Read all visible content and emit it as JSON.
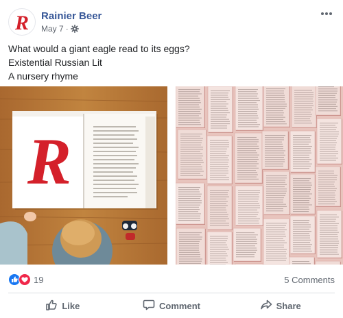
{
  "post": {
    "page_name": "Rainier Beer",
    "date": "May 7",
    "separator": "·",
    "audience_icon": "gear-icon",
    "more_icon": "more-options-icon",
    "text_lines": [
      "What would a giant eagle read to its eggs?",
      "Existential Russian Lit",
      "A nursery rhyme"
    ],
    "brand_color": "#d4202a"
  },
  "photos": [
    {
      "name": "photo-child-reading-book",
      "letter": "R"
    },
    {
      "name": "photo-book-pages-collage"
    }
  ],
  "reactions": {
    "icons": [
      "like-reaction-icon",
      "love-reaction-icon"
    ],
    "count": "19",
    "comments": "5 Comments"
  },
  "actions": {
    "like": "Like",
    "comment": "Comment",
    "share": "Share"
  },
  "colors": {
    "link": "#385898",
    "muted": "#606770",
    "like_blue": "#1877f2",
    "love_red": "#f0284a"
  }
}
